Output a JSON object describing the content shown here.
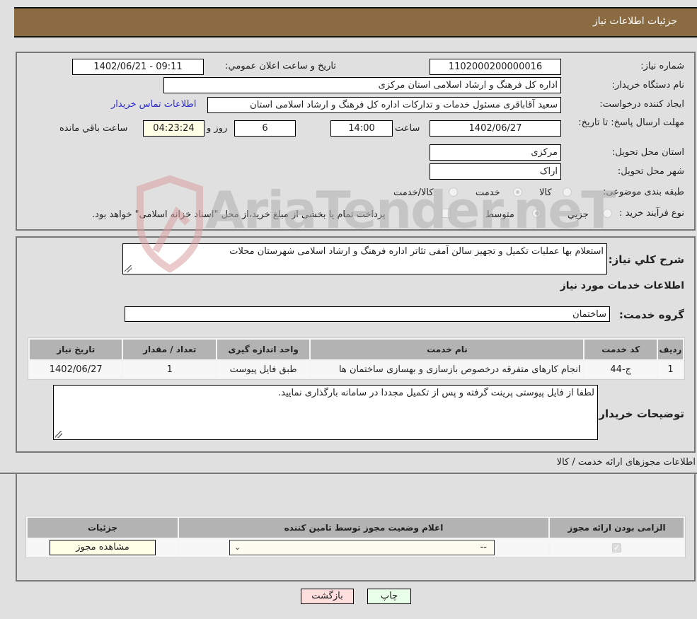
{
  "header": {
    "title": "جزئيات اطلاعات نیاز"
  },
  "details": {
    "need_number": {
      "label": "شماره نیاز:",
      "value": "1102000200000016"
    },
    "announce_datetime": {
      "label": "تاریخ و ساعت اعلان عمومي:",
      "value": "1402/06/21 - 09:11"
    },
    "buyer_org": {
      "label": "نام دستگاه خریدار:",
      "value": "اداره کل فرهنگ و ارشاد اسلامی استان مرکزی"
    },
    "requester": {
      "label": "ایجاد کننده درخواست:",
      "value": "سعید آقاباقری مسئول خدمات و تدارکات اداره کل فرهنگ و ارشاد اسلامی استان",
      "contact_link": "اطلاعات تماس خریدار"
    },
    "deadline": {
      "label": "مهلت ارسال پاسخ: تا تاریخ:",
      "date": "1402/06/27",
      "time_label": "ساعت",
      "time": "14:00",
      "days": "6",
      "days_label": "روز و",
      "remaining": "04:23:24",
      "remaining_label": "ساعت باقي مانده"
    },
    "province": {
      "label": "استان محل تحویل:",
      "value": "مرکزی"
    },
    "city": {
      "label": "شهر محل تحویل:",
      "value": "اراک"
    },
    "category": {
      "label": "طبقه بندی موضوعی:",
      "options": [
        "کالا",
        "خدمت",
        "کالا/خدمت"
      ],
      "selected": "خدمت"
    },
    "purchase_type": {
      "label": "نوع فرآیند خرید :",
      "options": [
        "جزيي",
        "متوسط"
      ],
      "selected": "متوسط",
      "treasury_note": "پرداخت تمام یا بخشی از مبلغ خرید،از محل \"اسناد خزانه اسلامی\" خواهد بود."
    }
  },
  "summary": {
    "description_label": "شرح كلي نياز:",
    "description": "استعلام بها عملیات تکمیل و تجهیز سالن آمفی تئاتر اداره فرهنگ و ارشاد اسلامی شهرستان محلات",
    "services_title": "اطلاعات خدمات مورد نیاز",
    "service_group_label": "گروه خدمت:",
    "service_group": "ساختمان",
    "table": {
      "headers": [
        "ردیف",
        "کد خدمت",
        "نام خدمت",
        "واحد اندازه گیری",
        "تعداد / مقدار",
        "تاریخ نیاز"
      ],
      "rows": [
        [
          "1",
          "ج-44",
          "انجام کارهای متفرقه درخصوص بازسازی و بهسازی ساختمان ها",
          "طبق فایل پیوست",
          "1",
          "1402/06/27"
        ]
      ]
    },
    "buyer_notes_label": "توضیحات خریدار:",
    "buyer_notes": "لطفا از فایل پیوستی پرینت گرفته و پس از تکمیل مجددا در سامانه بارگذاری نمایید."
  },
  "permits": {
    "title": "اطلاعات مجوزهای ارائه خدمت / کالا",
    "headers": [
      "الزامی بودن ارائه مجوز",
      "اعلام وضعیت مجوز توسط تامین کننده",
      "جزئیات"
    ],
    "row": {
      "required": true,
      "status_value": "--",
      "view_button": "مشاهده مجوز"
    }
  },
  "actions": {
    "print": "چاپ",
    "back": "بازگشت"
  },
  "watermark": {
    "text": "AriaTender.neT"
  },
  "colors": {
    "header_bg": "#8b6b42",
    "print_bg": "#eaffea",
    "back_bg": "#ffdede",
    "link": "#2b2bd6"
  }
}
